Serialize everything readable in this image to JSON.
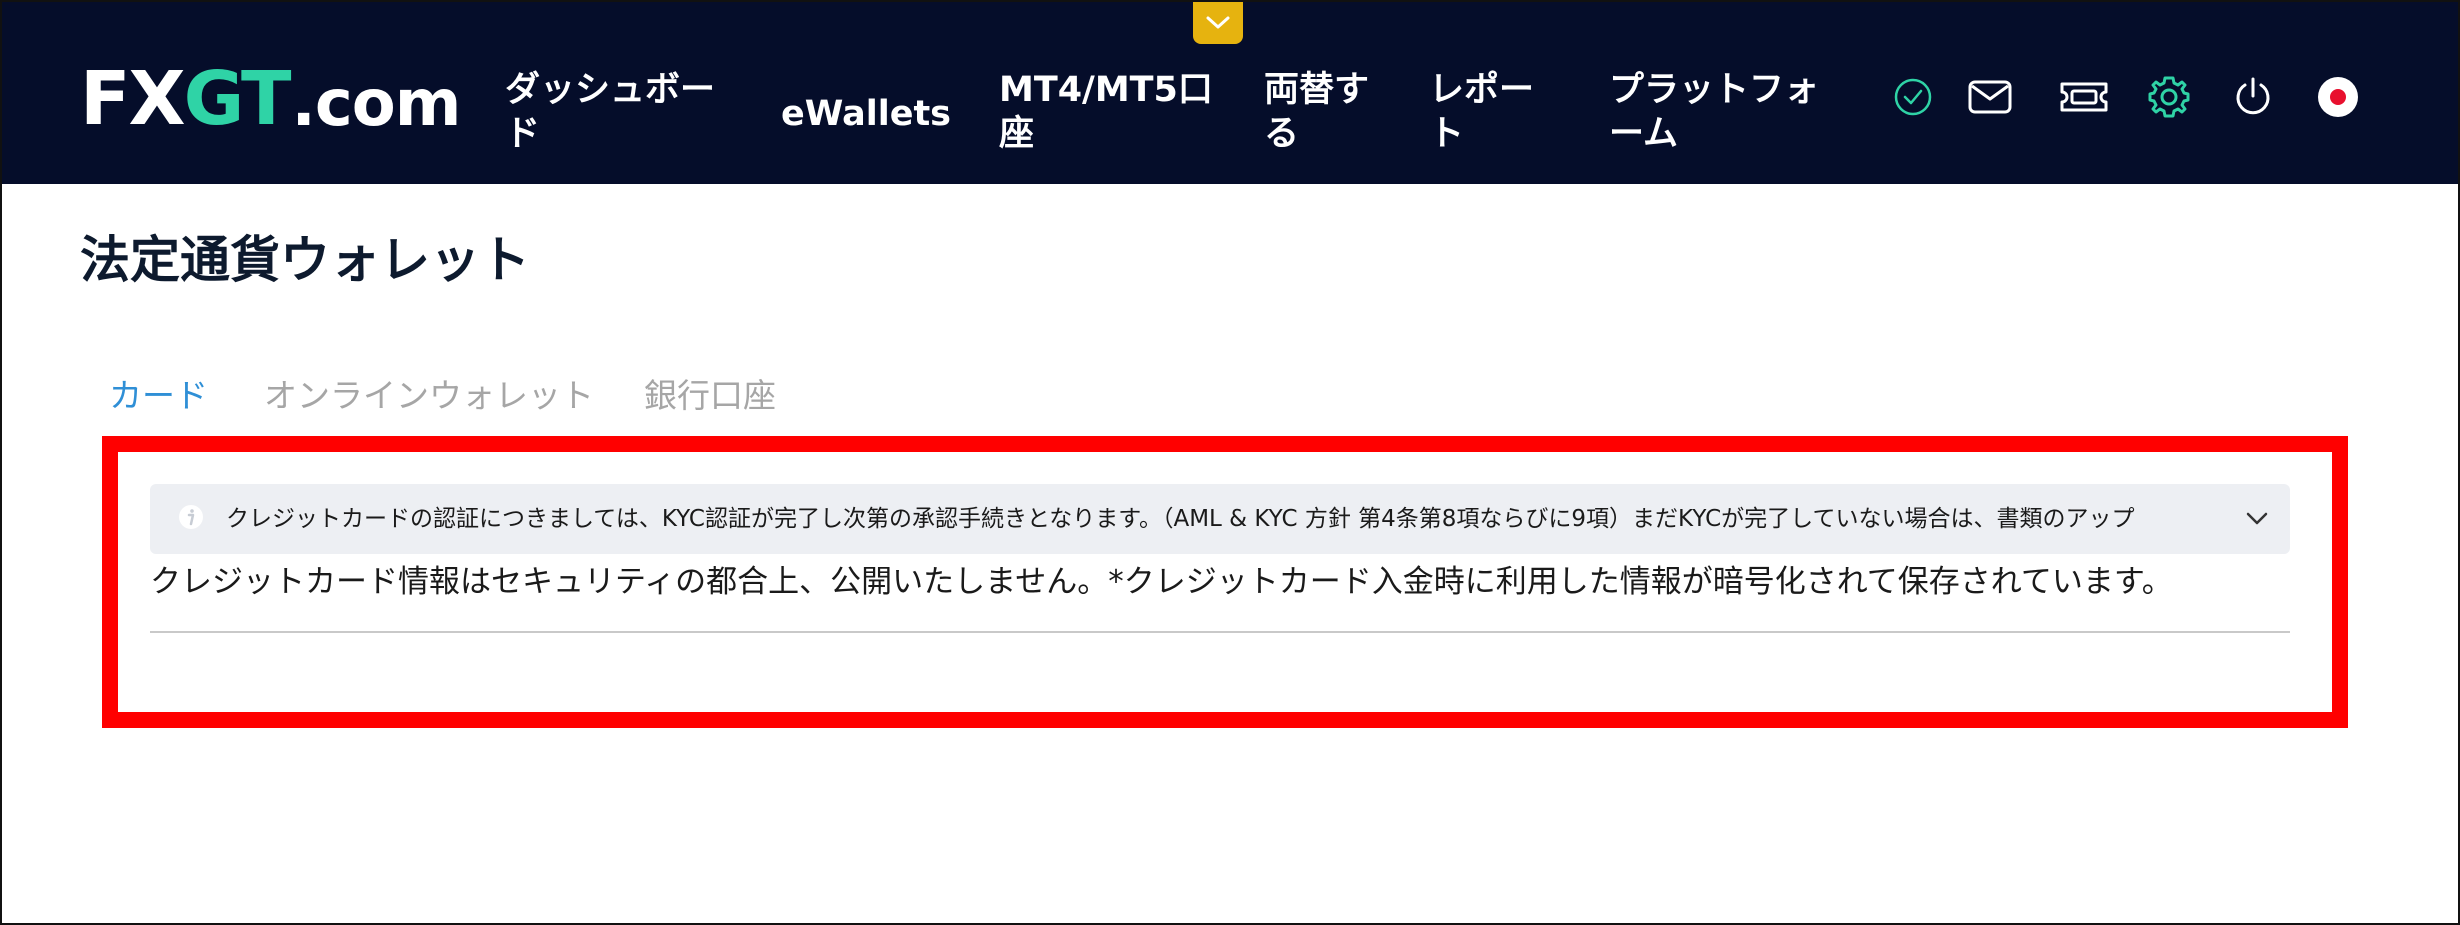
{
  "header": {
    "logo": {
      "part1": "FX",
      "part2": "GT",
      "part3": ".com"
    },
    "nav": {
      "dashboard": {
        "line1": "ダッシュボー",
        "line2": "ド"
      },
      "ewallets": {
        "line1": "eWallets"
      },
      "mt_accounts": {
        "line1": "MT4/MT5口",
        "line2": "座"
      },
      "exchange": {
        "line1": "両替す",
        "line2": "る"
      },
      "report": {
        "line1": "レポー",
        "line2": "ト"
      },
      "platform": {
        "line1": "プラットフォ",
        "line2": "ーム"
      }
    },
    "icons": [
      {
        "name": "verified-check-icon",
        "color": "#2fd3a6"
      },
      {
        "name": "mail-icon",
        "color": "#ffffff"
      },
      {
        "name": "ticket-icon",
        "color": "#ffffff"
      },
      {
        "name": "gear-icon",
        "color": "#2fd3a6"
      },
      {
        "name": "power-icon",
        "color": "#ffffff"
      },
      {
        "name": "japan-flag-icon",
        "color": "#e8102e"
      }
    ],
    "collapse_icon": "chevron-down-icon"
  },
  "page": {
    "title": "法定通貨ウォレット"
  },
  "tabs": [
    {
      "label": "カード",
      "active": true
    },
    {
      "label": "オンラインウォレット",
      "active": false
    },
    {
      "label": "銀行口座",
      "active": false
    }
  ],
  "info_banner": {
    "icon": "info-icon",
    "text": "クレジットカードの認証につきましては、KYC認証が完了し次第の承認手続きとなります。（AML & KYC 方針 第4条第8項ならびに9項）まだKYCが完了していない場合は、書類のアップ",
    "expand_icon": "chevron-down-icon"
  },
  "card_notice": "クレジットカード情報はセキュリティの都合上、公開いたしません。*クレジットカード入金時に利用した情報が暗号化されて保存されています。",
  "colors": {
    "header_bg": "#050d2a",
    "brand_accent": "#2fd3a6",
    "collapse_tab": "#e6b30f",
    "active_tab": "#2f8fd6",
    "highlight_border": "#ff0000"
  }
}
